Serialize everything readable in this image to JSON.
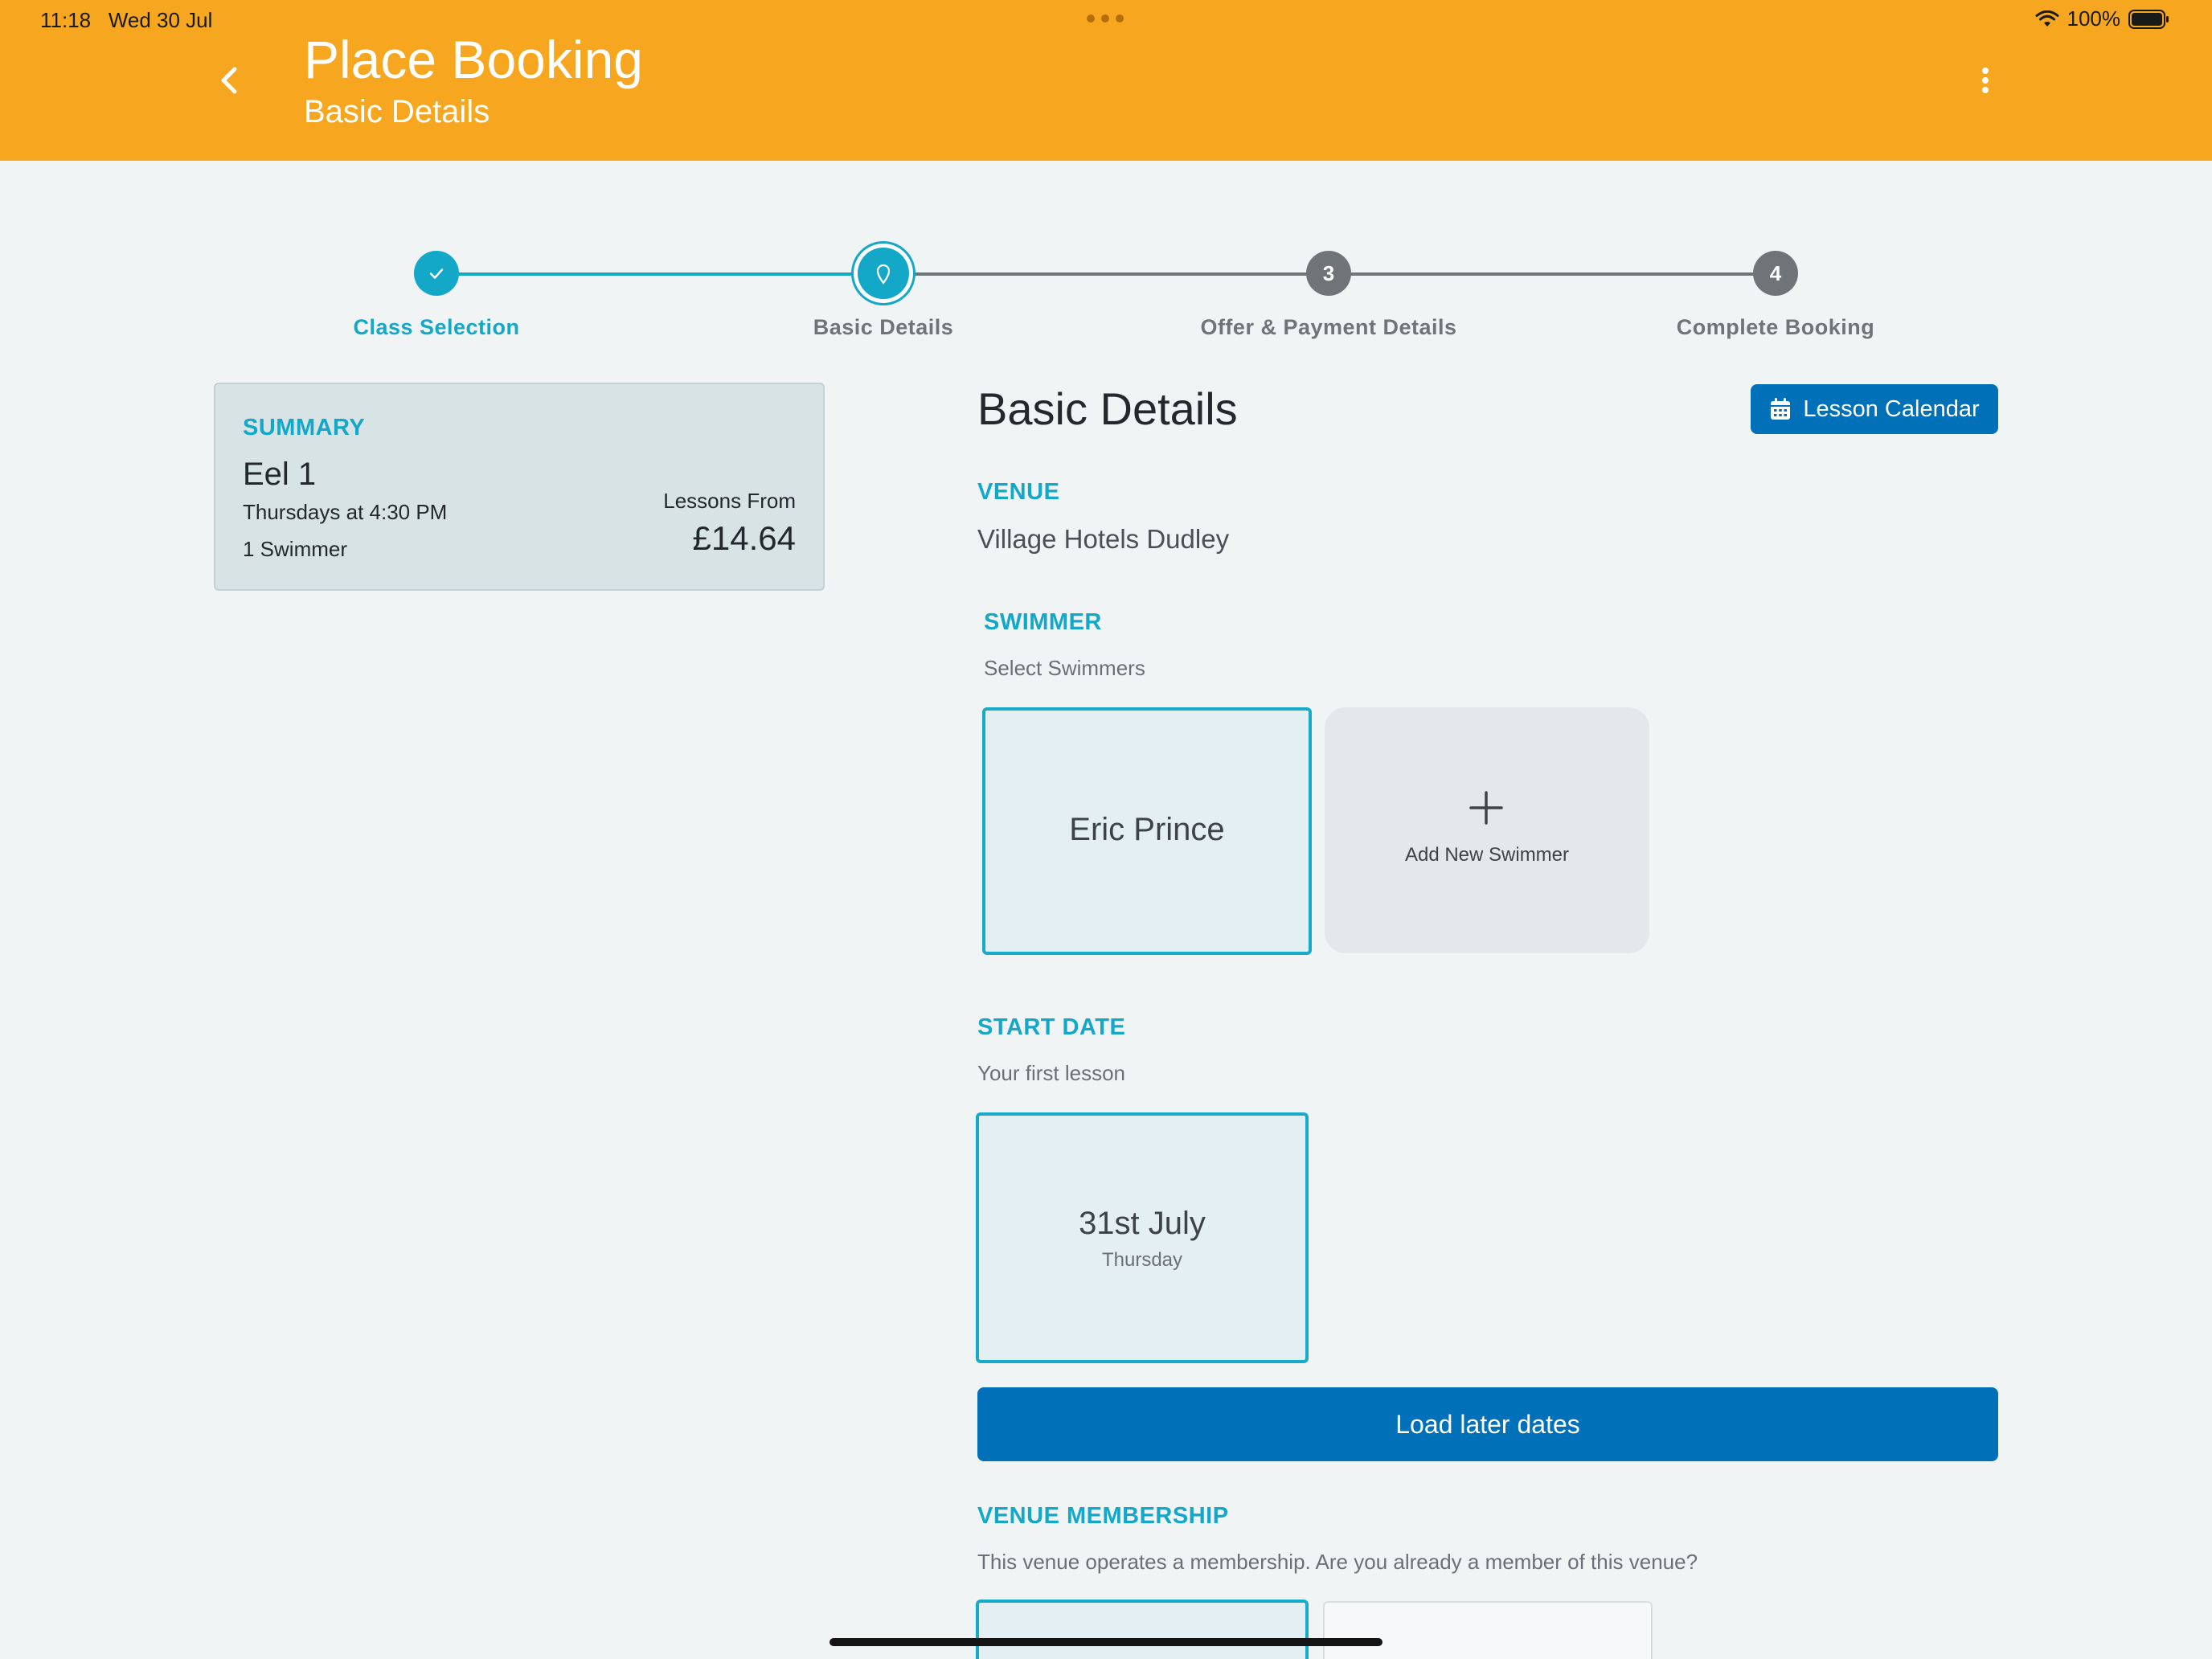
{
  "status_bar": {
    "time": "11:18",
    "date": "Wed 30 Jul",
    "battery": "100%",
    "icons": [
      "wifi-icon",
      "battery-icon"
    ]
  },
  "header": {
    "title": "Place Booking",
    "subtitle": "Basic Details",
    "background_color": "#f6a71f",
    "icons": [
      "back-icon",
      "more-icon"
    ]
  },
  "stepper": {
    "steps": [
      {
        "label": "Class Selection",
        "marker": "check-icon",
        "state": "completed"
      },
      {
        "label": "Basic Details",
        "marker": "pin-icon",
        "state": "current"
      },
      {
        "label": "Offer & Payment Details",
        "marker": "3",
        "state": "upcoming"
      },
      {
        "label": "Complete Booking",
        "marker": "4",
        "state": "upcoming"
      }
    ],
    "active_color": "#13a7c8",
    "inactive_color": "#6f7479"
  },
  "summary": {
    "heading": "SUMMARY",
    "class_name": "Eel 1",
    "schedule": "Thursdays at 4:30 PM",
    "swimmers": "1 Swimmer",
    "price_label": "Lessons From",
    "price": "£14.64"
  },
  "main": {
    "title": "Basic Details",
    "calendar_button": "Lesson Calendar",
    "venue": {
      "label": "VENUE",
      "name": "Village Hotels Dudley"
    },
    "swimmer": {
      "label": "SWIMMER",
      "hint": "Select Swimmers",
      "selected": "Eric Prince",
      "add_label": "Add New Swimmer"
    },
    "start_date": {
      "label": "START DATE",
      "hint": "Your first lesson",
      "date": "31st July",
      "weekday": "Thursday"
    },
    "load_button": "Load later dates",
    "membership": {
      "label": "VENUE MEMBERSHIP",
      "question": "This venue operates a membership. Are you already a member of this venue?"
    }
  },
  "colors": {
    "accent": "#13a7c8",
    "primary_button": "#0070b9",
    "page_background": "#f0f4f5"
  }
}
